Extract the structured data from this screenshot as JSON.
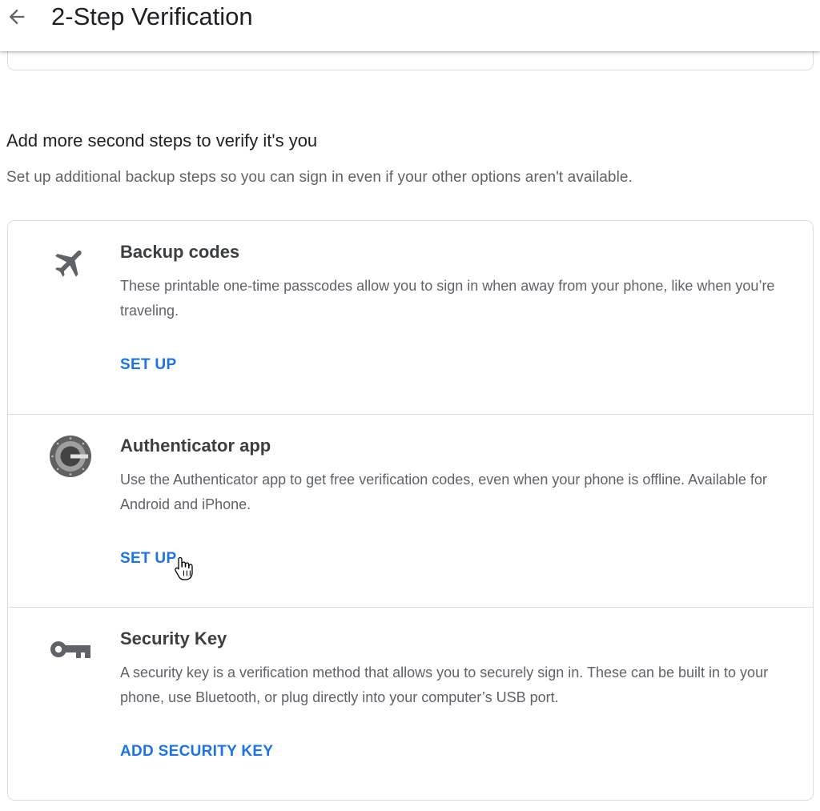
{
  "header": {
    "title": "2-Step Verification",
    "back_icon": "back-arrow-icon"
  },
  "section": {
    "heading": "Add more second steps to verify it's you",
    "subtitle": "Set up additional backup steps so you can sign in even if your other options aren't available."
  },
  "options": [
    {
      "icon": "airplane-icon",
      "title": "Backup codes",
      "description": "These printable one-time passcodes allow you to sign in when away from your phone, like when you’re traveling.",
      "action": "SET UP"
    },
    {
      "icon": "authenticator-icon",
      "title": "Authenticator app",
      "description": "Use the Authenticator app to get free verification codes, even when your phone is offline. Available for Android and iPhone.",
      "action": "SET UP"
    },
    {
      "icon": "key-icon",
      "title": "Security Key",
      "description": "A security key is a verification method that allows you to securely sign in. These can be built in to your phone, use Bluetooth, or plug directly into your computer’s USB port.",
      "action": "ADD SECURITY KEY"
    }
  ],
  "colors": {
    "accent": "#1a73e8",
    "icon_gray": "#5f6368",
    "divider": "#dadce0"
  }
}
